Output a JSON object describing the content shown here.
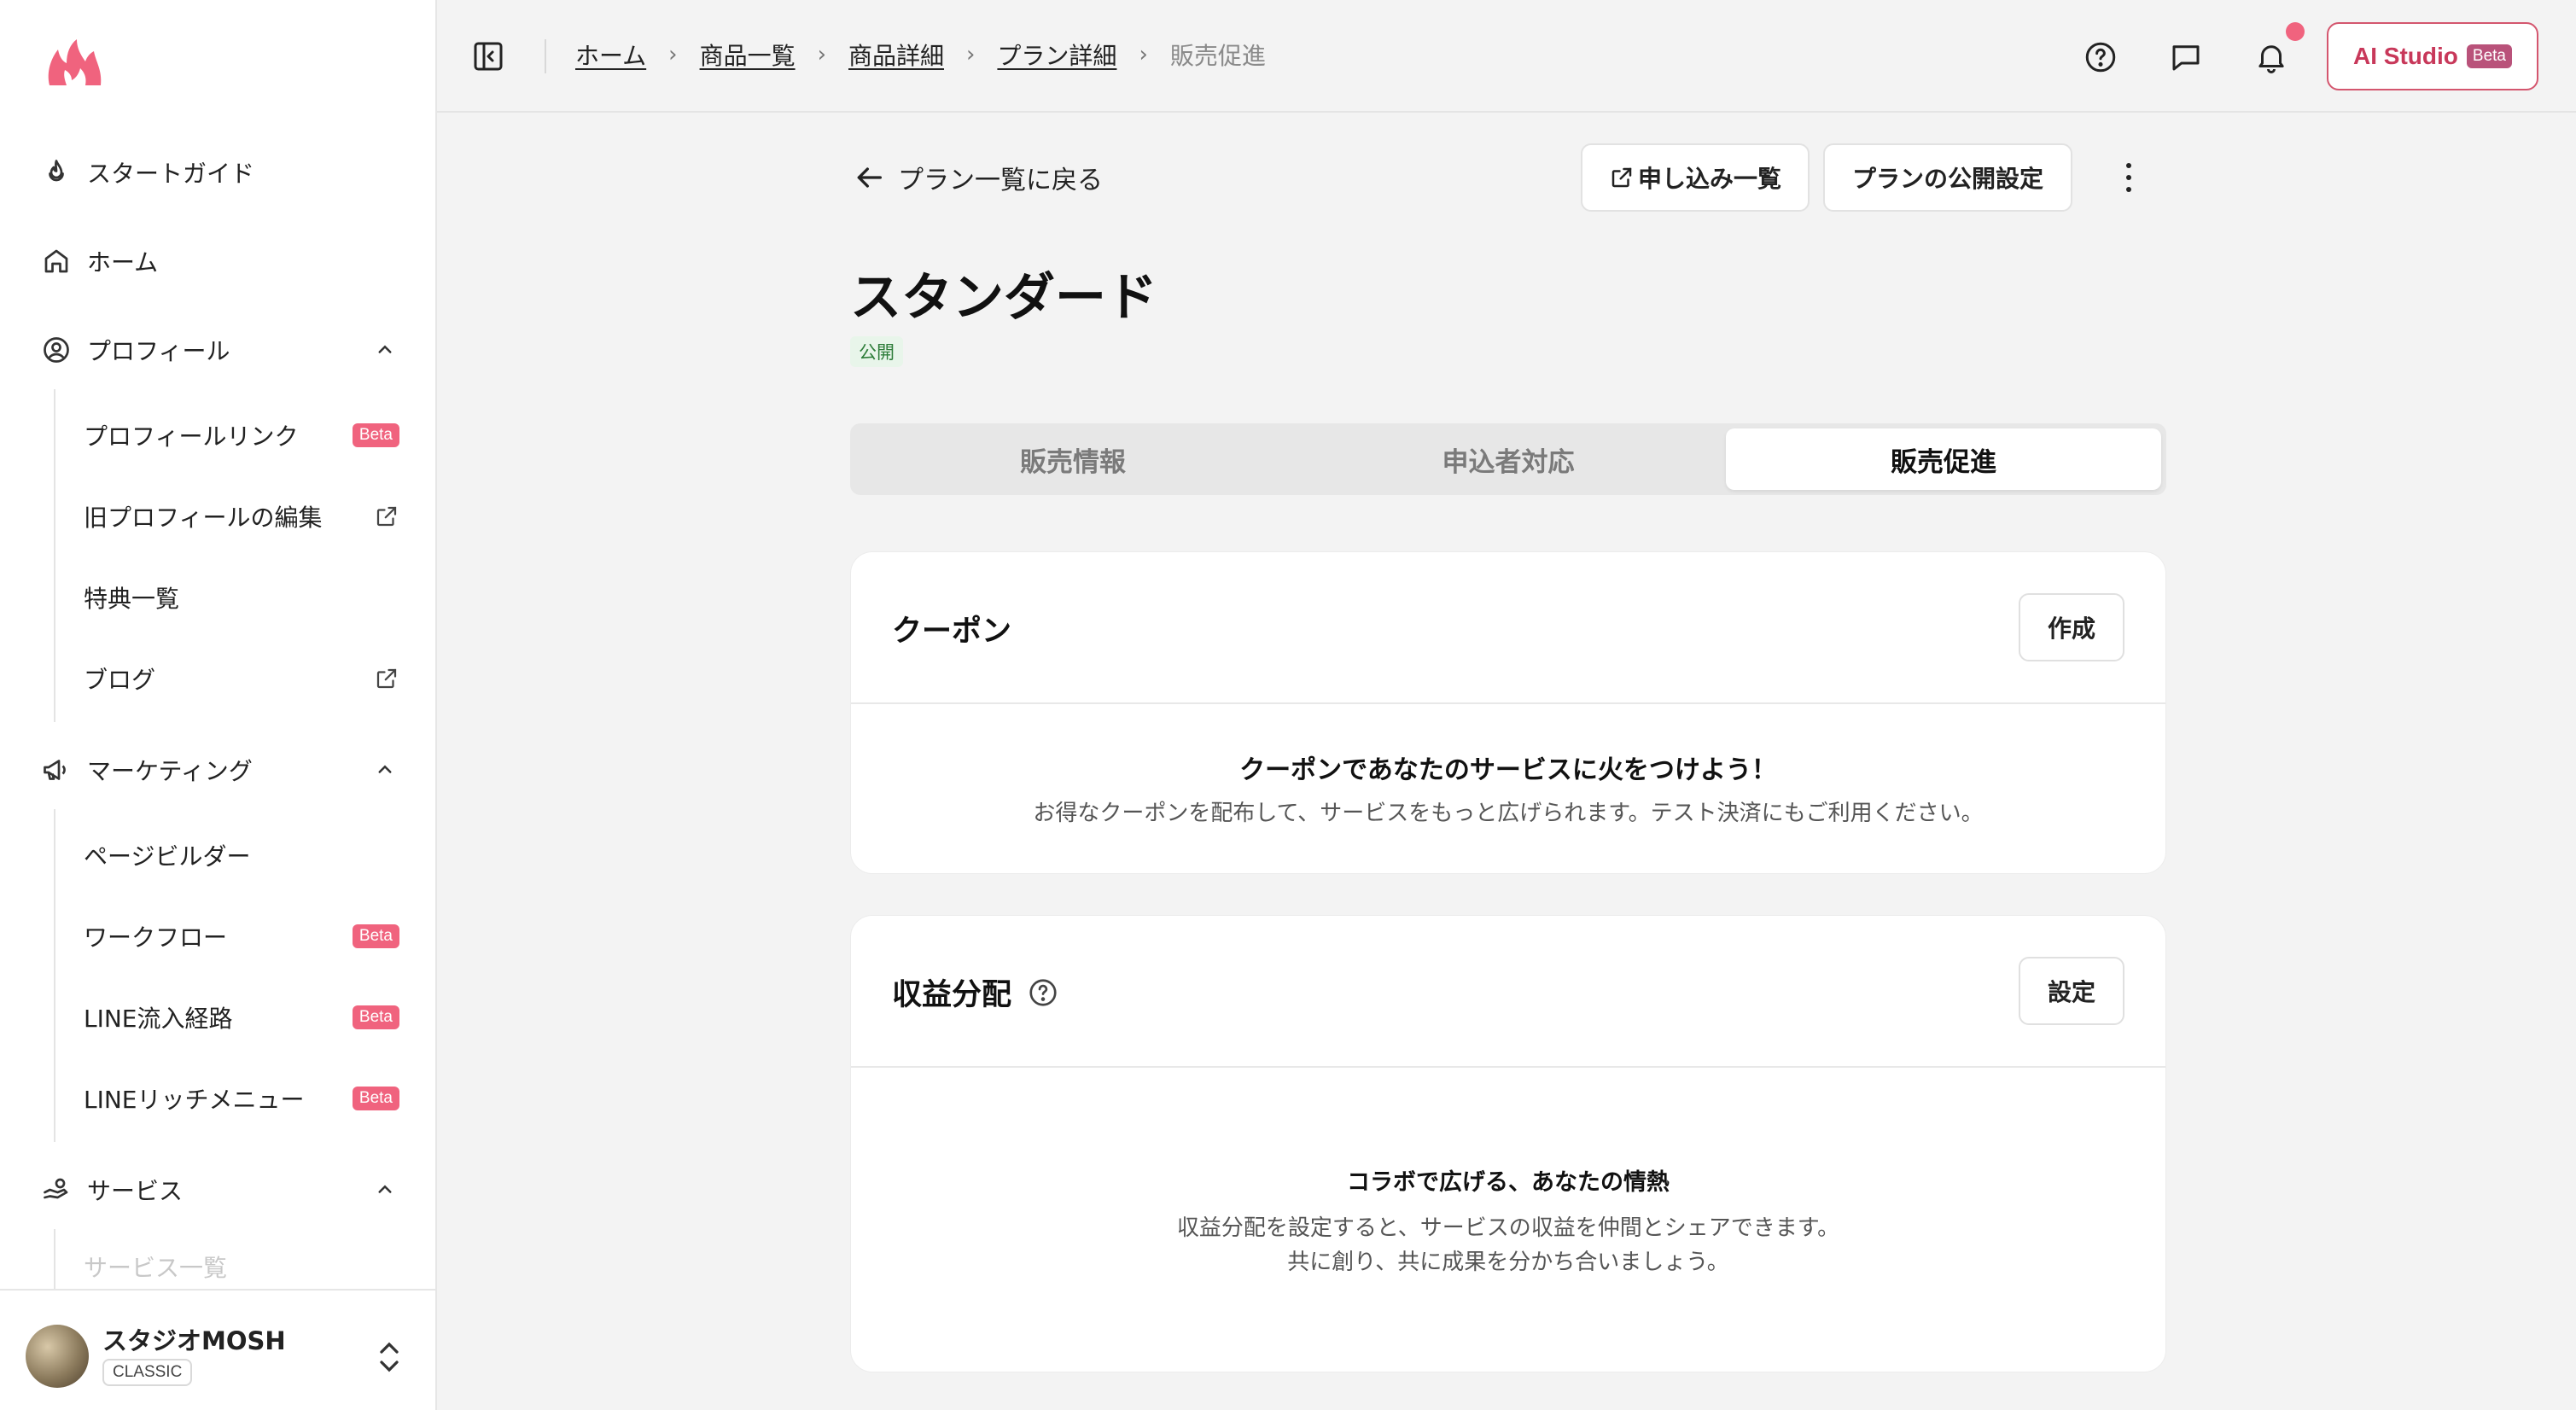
{
  "sidebar": {
    "items": {
      "start_guide": "スタートガイド",
      "home": "ホーム",
      "profile": "プロフィール",
      "marketing": "マーケティング",
      "service": "サービス"
    },
    "profile_sub": {
      "profile_link": "プロフィールリンク",
      "old_profile_edit": "旧プロフィールの編集",
      "perks": "特典一覧",
      "blog": "ブログ"
    },
    "marketing_sub": {
      "page_builder": "ページビルダー",
      "workflow": "ワークフロー",
      "line_route": "LINE流入経路",
      "line_rich_menu": "LINEリッチメニュー"
    },
    "service_sub": {
      "service_list": "サービス一覧"
    },
    "beta_label": "Beta",
    "footer": {
      "name": "スタジオMOSH",
      "plan": "CLASSIC"
    }
  },
  "breadcrumb": {
    "home": "ホーム",
    "products": "商品一覧",
    "product_detail": "商品詳細",
    "plan_detail": "プラン詳細",
    "current": "販売促進"
  },
  "topbar": {
    "ai_studio": "AI Studio",
    "ai_beta": "Beta"
  },
  "main": {
    "back": "プラン一覧に戻る",
    "applications_btn": "申し込み一覧",
    "publish_settings_btn": "プランの公開設定",
    "title": "スタンダード",
    "status": "公開",
    "tabs": {
      "sales_info": "販売情報",
      "applicants": "申込者対応",
      "promotion": "販売促進"
    }
  },
  "coupon": {
    "title": "クーポン",
    "button": "作成",
    "empty_title": "クーポンであなたのサービスに火をつけよう！",
    "empty_desc": "お得なクーポンを配布して、サービスをもっと広げられます。テスト決済にもご利用ください。"
  },
  "revenue": {
    "title": "収益分配",
    "button": "設定",
    "empty_title": "コラボで広げる、あなたの情熱",
    "empty_desc_1": "収益分配を設定すると、サービスの収益を仲間とシェアできます。",
    "empty_desc_2": "共に創り、共に成果を分かち合いましょう。"
  },
  "colors": {
    "accent": "#f0637e",
    "brand_outline": "#d4566e",
    "status_green": "#2e7d3a"
  }
}
